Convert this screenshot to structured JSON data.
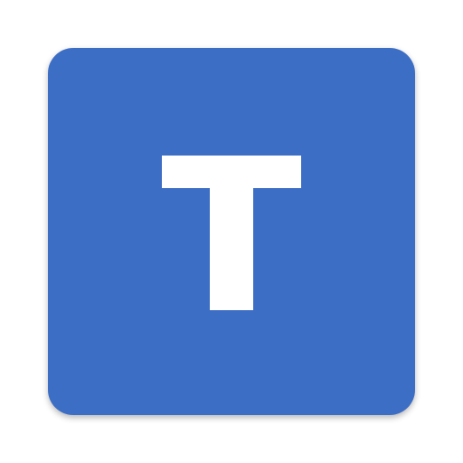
{
  "app_icon": {
    "letter": "T",
    "colors": {
      "background": "#3d6ec5",
      "glyph": "#ffffff"
    },
    "icon_name": "letter-t-app-icon"
  }
}
